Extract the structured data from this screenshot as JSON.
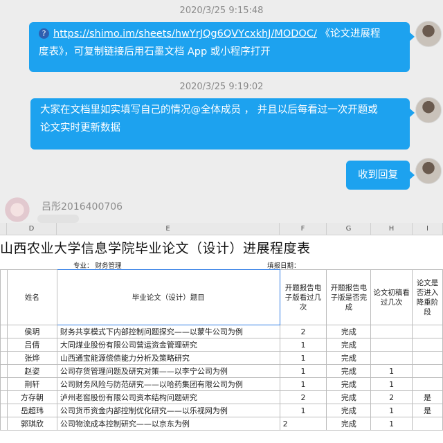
{
  "chat": {
    "timestamp_1": "2020/3/25 9:15:48",
    "message_1": {
      "link_text": "https://shimo.im/sheets/hwYrJQg6QVYcxkhJ/MODOC/",
      "text_part_1": " 《论文进展程",
      "text_part_2": "度表》，可复制链接后用石墨文档 App 或小程序打开"
    },
    "timestamp_2": "2020/3/25 9:19:02",
    "message_2": {
      "line_1": "大家在文档里如实填写自己的情况@全体成员 ， 并且以后每看过一次开题或",
      "line_2": "论文实时更新数据"
    },
    "message_3": "收到回复",
    "sender_name": "吕彤2016400706",
    "link_icon_glyph": "?",
    "bubble_color": "#1da2ef"
  },
  "sheet": {
    "columns": [
      "D",
      "E",
      "F",
      "G",
      "H",
      "I"
    ],
    "title": "山西农业大学信息学院毕业论文（设计）进展程度表",
    "major_label": "专业：  财务管理",
    "date_label": "填报日期：",
    "headers": {
      "name": "姓名",
      "title": "毕业论文（设计）题目",
      "proposal_views": "开题报告电子版看过几次",
      "proposal_done": "开题报告电子版是否完成",
      "draft_views": "论文初稿看过几次",
      "plagiarism": "论文是否进入降重阶段"
    },
    "rows": [
      {
        "name": "侯玥",
        "title": "财务共享模式下内部控制问题探究——以蒙牛公司为例",
        "proposal_views": "2",
        "proposal_done": "完成",
        "draft_views": "",
        "plagiarism": ""
      },
      {
        "name": "吕倩",
        "title": "大同煤业股份有限公司营运资金管理研究",
        "proposal_views": "1",
        "proposal_done": "完成",
        "draft_views": "",
        "plagiarism": ""
      },
      {
        "name": "张烨",
        "title": "山西通宝能源偿债能力分析及策略研究",
        "proposal_views": "1",
        "proposal_done": "完成",
        "draft_views": "",
        "plagiarism": ""
      },
      {
        "name": "赵姿",
        "title": "公司存货管理问题及研究对策——以李宁公司为例",
        "proposal_views": "1",
        "proposal_done": "完成",
        "draft_views": "1",
        "plagiarism": ""
      },
      {
        "name": "荆轩",
        "title": "公司财务风险与防范研究——以哈药集团有限公司为例",
        "proposal_views": "1",
        "proposal_done": "完成",
        "draft_views": "1",
        "plagiarism": ""
      },
      {
        "name": "方存朝",
        "title": "泸州老窖股份有限公司资本结构问题研究",
        "proposal_views": "2",
        "proposal_done": "完成",
        "draft_views": "2",
        "plagiarism": "是"
      },
      {
        "name": "岳超玮",
        "title": "公司货币资金内部控制优化研究——以乐视网为例",
        "proposal_views": "1",
        "proposal_done": "完成",
        "draft_views": "1",
        "plagiarism": "是"
      },
      {
        "name": "郭琪欣",
        "title": "公司物流成本控制研究——以京东为例",
        "proposal_views": "2",
        "proposal_done": "完成",
        "draft_views": "1",
        "plagiarism": ""
      }
    ]
  }
}
